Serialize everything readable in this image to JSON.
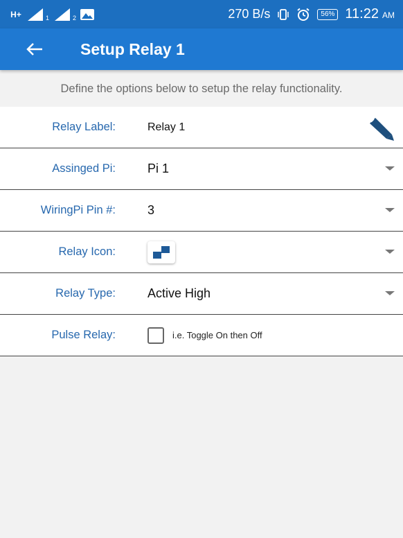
{
  "status_bar": {
    "network_tag": "H+",
    "sim1": "1",
    "sim2": "2",
    "speed": "270 B/s",
    "battery": "56%",
    "time": "11:22",
    "ampm": "AM"
  },
  "app_bar": {
    "title": "Setup Relay 1",
    "back_icon": "arrow-left-icon"
  },
  "description": "Define the options below to setup the relay functionality.",
  "form": {
    "relay_label": {
      "label": "Relay Label:",
      "value": "Relay 1",
      "icon": "pencil-icon"
    },
    "assigned_pi": {
      "label": "Assinged Pi:",
      "value": "Pi 1"
    },
    "wiring_pin": {
      "label": "WiringPi Pin #:",
      "value": "3"
    },
    "relay_icon": {
      "label": "Relay Icon:",
      "icon": "relay-icon"
    },
    "relay_type": {
      "label": "Relay Type:",
      "value": "Active High"
    },
    "pulse_relay": {
      "label": "Pulse Relay:",
      "checked": false,
      "checkbox_text": "i.e. Toggle On then Off"
    }
  },
  "colors": {
    "status_bar": "#1c6fc0",
    "app_bar": "#1f79d2",
    "label_text": "#2768ae",
    "background": "#f2f2f2"
  }
}
